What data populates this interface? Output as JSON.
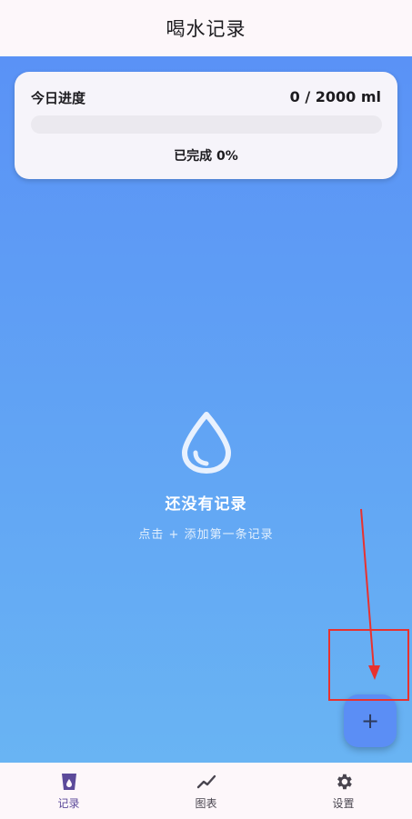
{
  "app_bar": {
    "title": "喝水记录"
  },
  "progress_card": {
    "title": "今日进度",
    "amount": "0 / 2000 ml",
    "status": "已完成 0%",
    "progress_fraction": 0
  },
  "empty_state": {
    "icon": "water-drop-icon",
    "title": "还没有记录",
    "subtitle": "点击 + 添加第一条记录"
  },
  "fab": {
    "label": "+",
    "icon": "add-icon"
  },
  "bottom_nav": {
    "items": [
      {
        "label": "记录",
        "icon": "cup-icon",
        "active": true
      },
      {
        "label": "图表",
        "icon": "chart-icon",
        "active": false
      },
      {
        "label": "设置",
        "icon": "gear-icon",
        "active": false
      }
    ]
  },
  "colors": {
    "accent": "#5b8ef5",
    "gradient_top": "#5a92f6",
    "gradient_bottom": "#69b4f3",
    "active_nav": "#5c4a9a",
    "annotation_red": "#e8322f"
  }
}
